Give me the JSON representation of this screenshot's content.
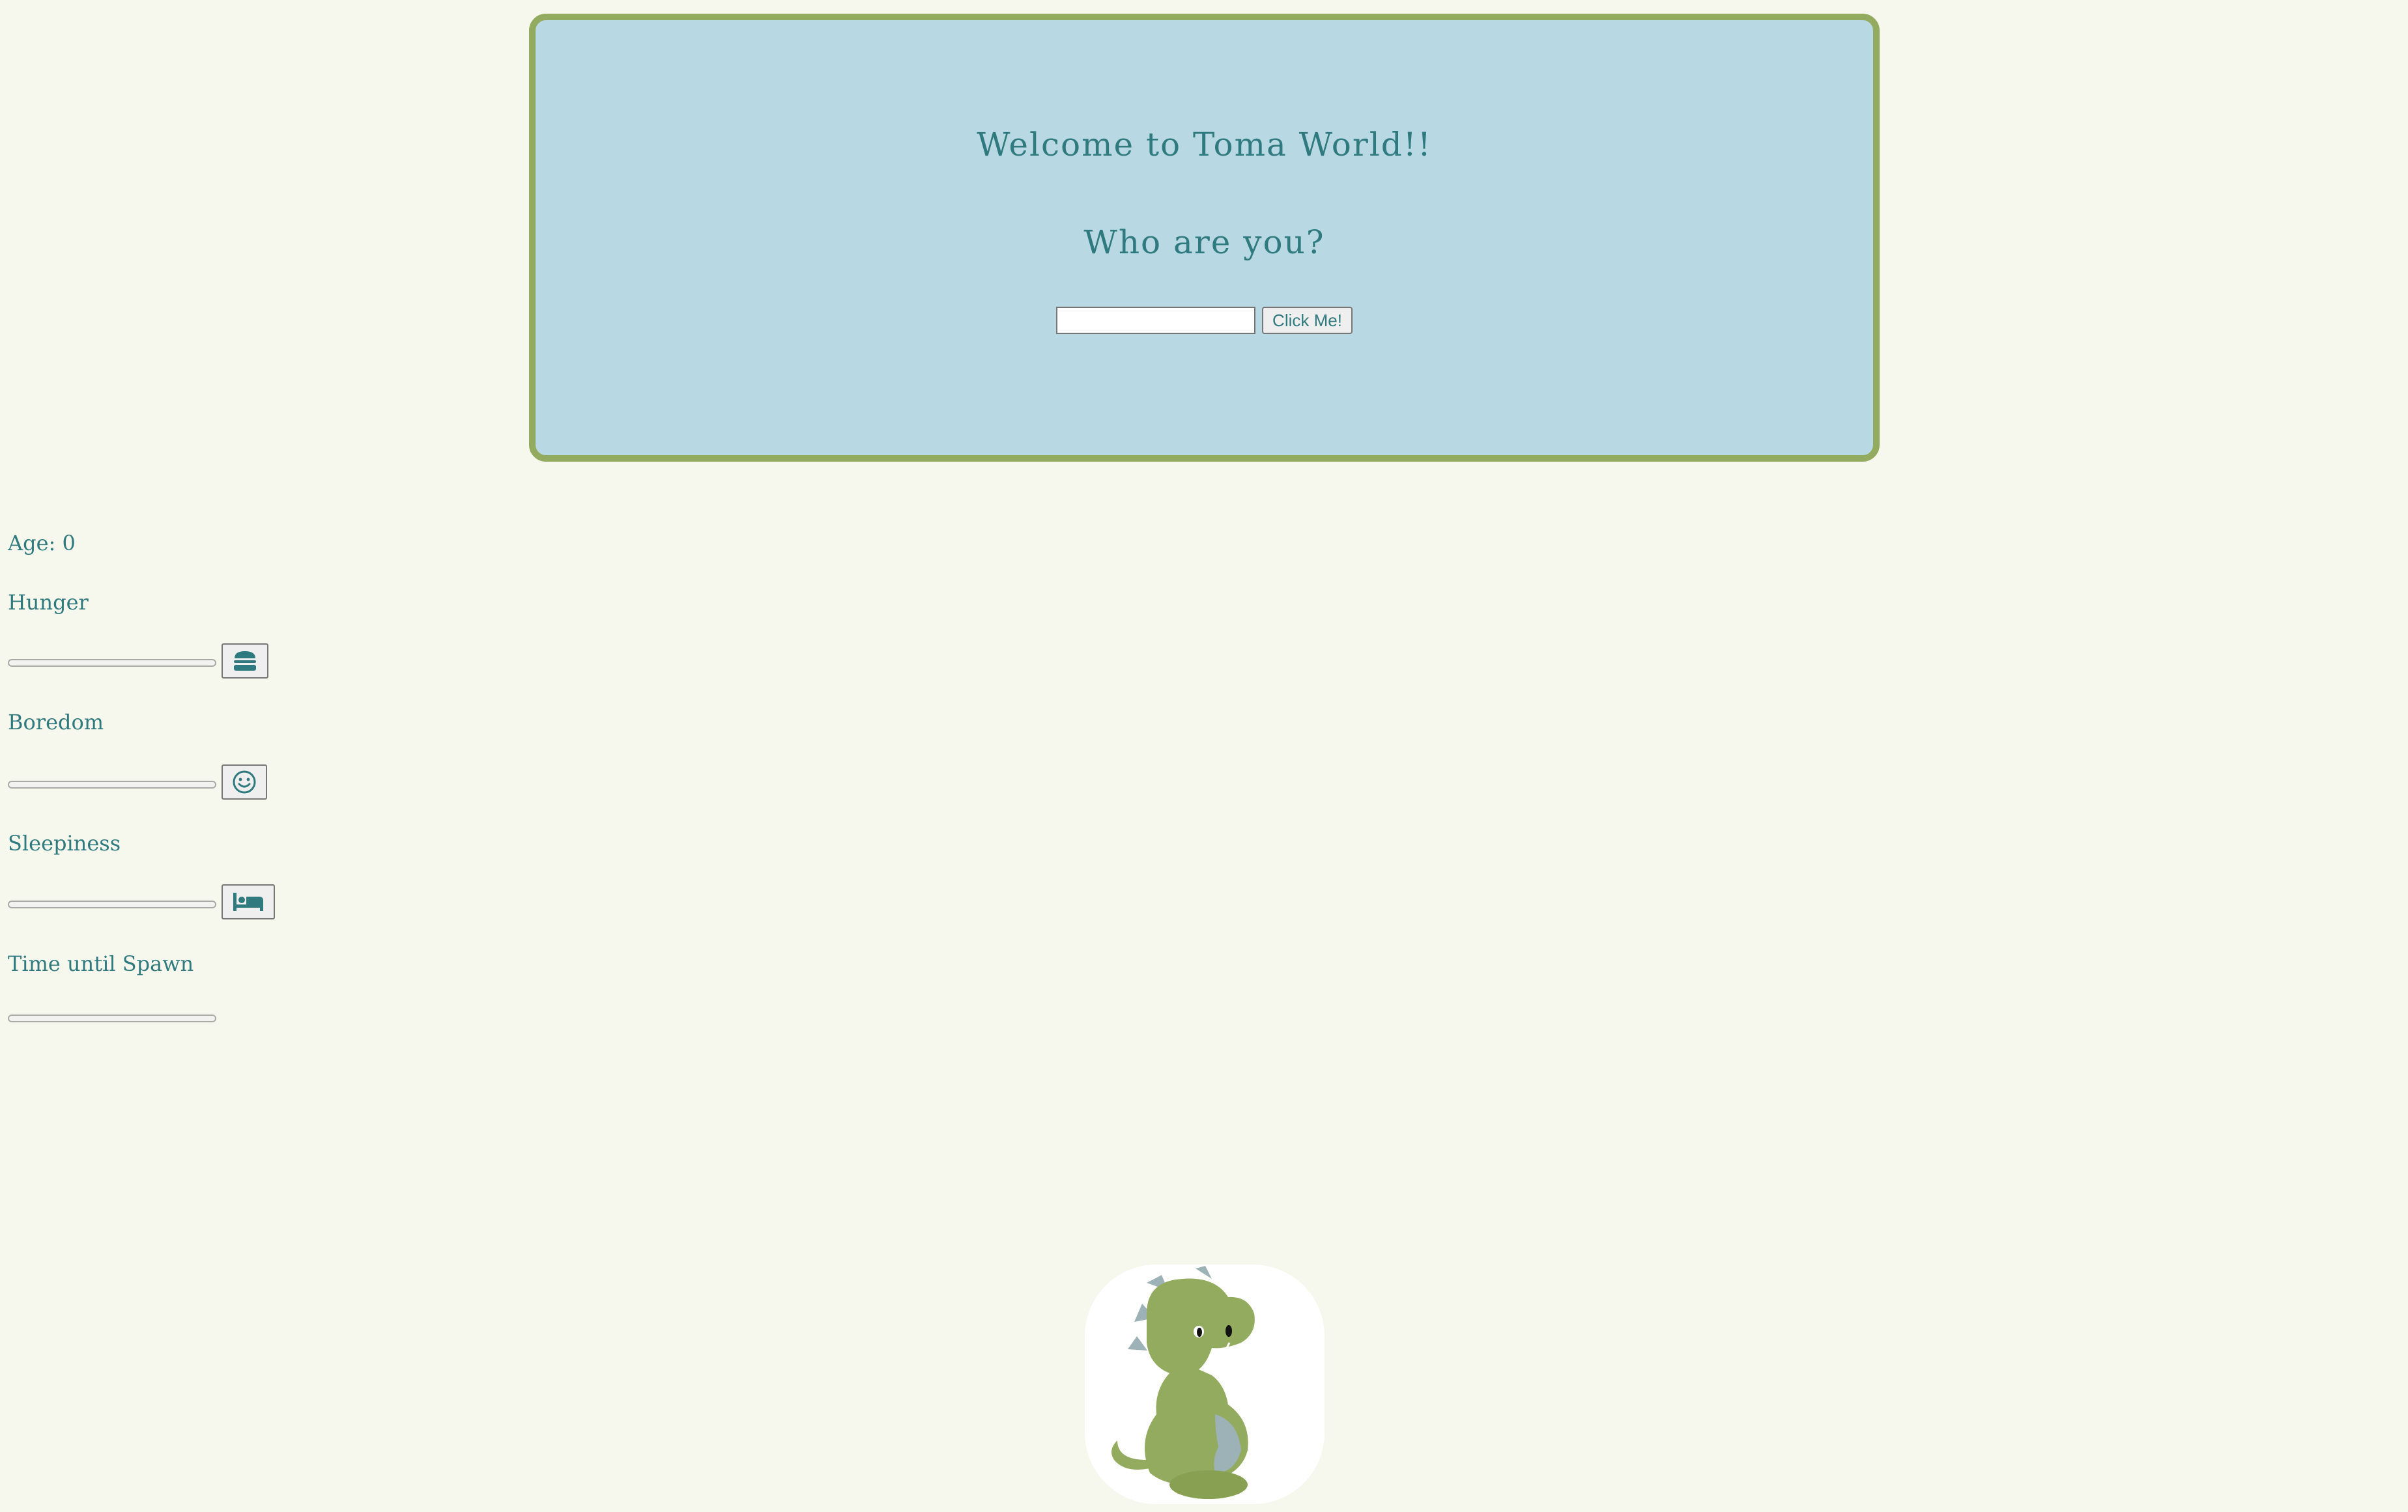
{
  "welcome": {
    "title": "Welcome to Toma World!!",
    "question": "Who are you?",
    "name_value": "",
    "button_label": "Click Me!"
  },
  "stats": {
    "age_label": "Age: 0",
    "hunger": {
      "label": "Hunger",
      "level": 0,
      "icon": "hamburger-icon"
    },
    "boredom": {
      "label": "Boredom",
      "level": 0,
      "icon": "smile-icon"
    },
    "sleepiness": {
      "label": "Sleepiness",
      "level": 0,
      "icon": "bed-icon"
    },
    "spawn": {
      "label": "Time until Spawn",
      "level": 0
    }
  },
  "pet": {
    "image": "dinosaur-icon"
  },
  "colors": {
    "background": "#f6f8ee",
    "panel": "#b8d8e3",
    "panel_border": "#93ab5f",
    "text": "#2f7a7e",
    "dino_green": "#93ab5f",
    "dino_gray": "#9db2b6"
  }
}
